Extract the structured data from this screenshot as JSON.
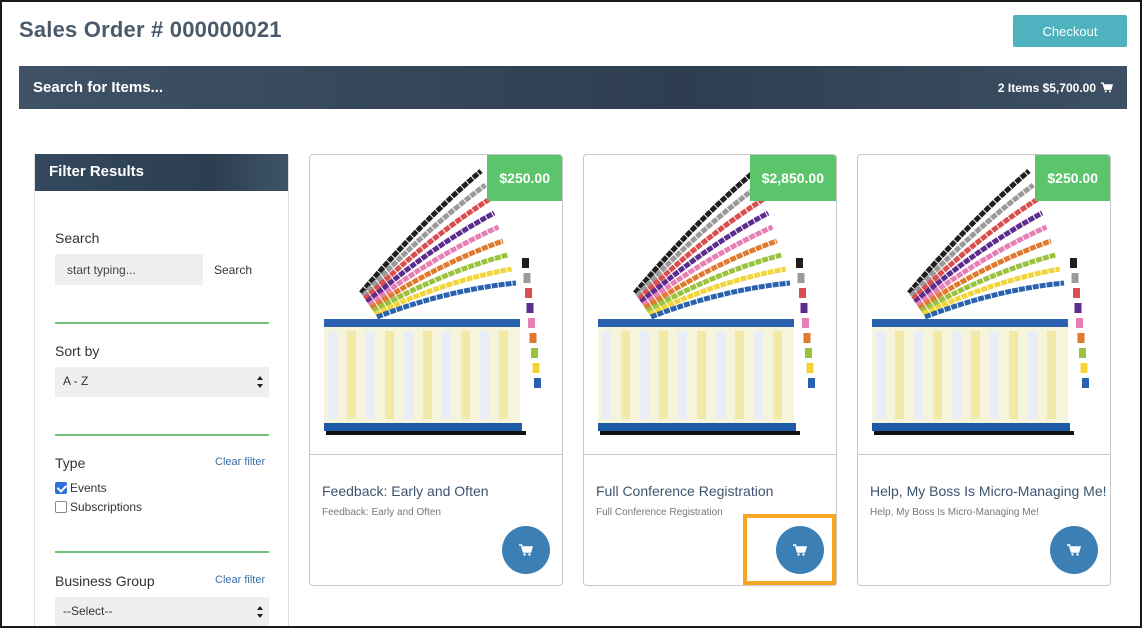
{
  "page": {
    "title": "Sales Order # 000000021"
  },
  "header": {
    "checkout_label": "Checkout"
  },
  "search_bar": {
    "label": "Search for Items...",
    "cart_summary": "2 Items $5,700.00",
    "cart_icon": "shopping-cart-icon"
  },
  "sidebar": {
    "title": "Filter Results",
    "search": {
      "label": "Search",
      "placeholder": "start typing...",
      "button_label": "Search"
    },
    "sort": {
      "label": "Sort by",
      "selected": "A - Z"
    },
    "type": {
      "label": "Type",
      "clear_label": "Clear filter",
      "options": [
        {
          "label": "Events",
          "checked": true
        },
        {
          "label": "Subscriptions",
          "checked": false
        }
      ]
    },
    "business_group": {
      "label": "Business Group",
      "clear_label": "Clear filter",
      "selected": "--Select--"
    }
  },
  "products": [
    {
      "price": "$250.00",
      "title": "Feedback: Early and Often",
      "subtitle": "Feedback: Early and Often"
    },
    {
      "price": "$2,850.00",
      "title": "Full Conference Registration",
      "subtitle": "Full Conference Registration"
    },
    {
      "price": "$250.00",
      "title": "Help, My Boss Is Micro-Managing Me!",
      "subtitle": "Help, My Boss Is Micro-Managing Me!"
    }
  ],
  "colors": {
    "accent_teal": "#4fb3bf",
    "price_green": "#5cc46a",
    "cart_blue": "#3b7fb5",
    "divider_green": "#74c27a",
    "highlight_orange": "#f5a623",
    "header_navy": "#2e3e50"
  }
}
